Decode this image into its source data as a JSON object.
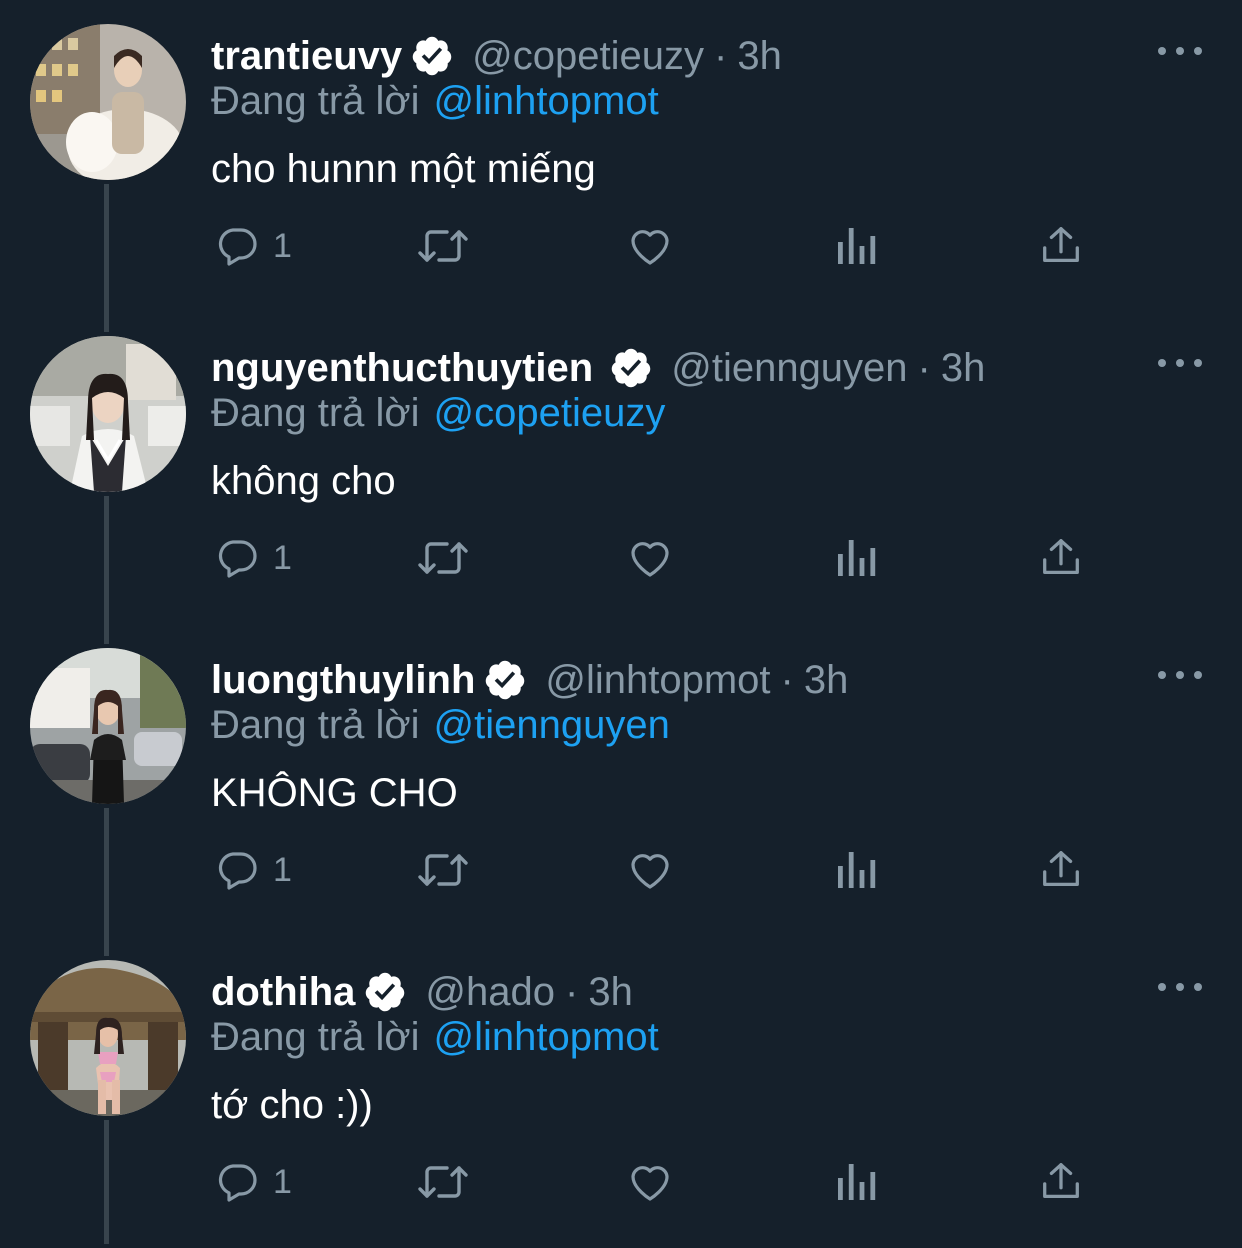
{
  "colors": {
    "background": "#15202b",
    "name": "#ffffff",
    "secondary_text": "#8899a6",
    "mention": "#1da1f2",
    "thread_line": "#38444d",
    "verified_badge": "#ffffff"
  },
  "icons": {
    "verified": "verified-badge-icon",
    "more": "more-options-icon",
    "reply": "reply-icon",
    "retweet": "retweet-icon",
    "like": "like-icon",
    "stats": "analytics-icon",
    "share": "share-icon"
  },
  "tweets": [
    {
      "display_name": "trantieuvy",
      "handle": "@copetieuzy",
      "separator": "·",
      "time": "3h",
      "reply_prefix": "Đang trả lời",
      "reply_to": "@linhtopmot",
      "text": "cho hunnn một miếng",
      "reply_count": "1"
    },
    {
      "display_name": "nguyenthucthuytien",
      "handle": "@tiennguyen",
      "separator": "·",
      "time": "3h",
      "reply_prefix": "Đang trả lời",
      "reply_to": "@copetieuzy",
      "text": "không cho",
      "reply_count": "1"
    },
    {
      "display_name": "luongthuylinh",
      "handle": "@linhtopmot",
      "separator": "·",
      "time": "3h",
      "reply_prefix": "Đang trả lời",
      "reply_to": "@tiennguyen",
      "text": "KHÔNG CHO",
      "reply_count": "1"
    },
    {
      "display_name": "dothiha",
      "handle": "@hado",
      "separator": "·",
      "time": "3h",
      "reply_prefix": "Đang trả lời",
      "reply_to": "@linhtopmot",
      "text": "tớ cho :))",
      "reply_count": "1"
    }
  ]
}
